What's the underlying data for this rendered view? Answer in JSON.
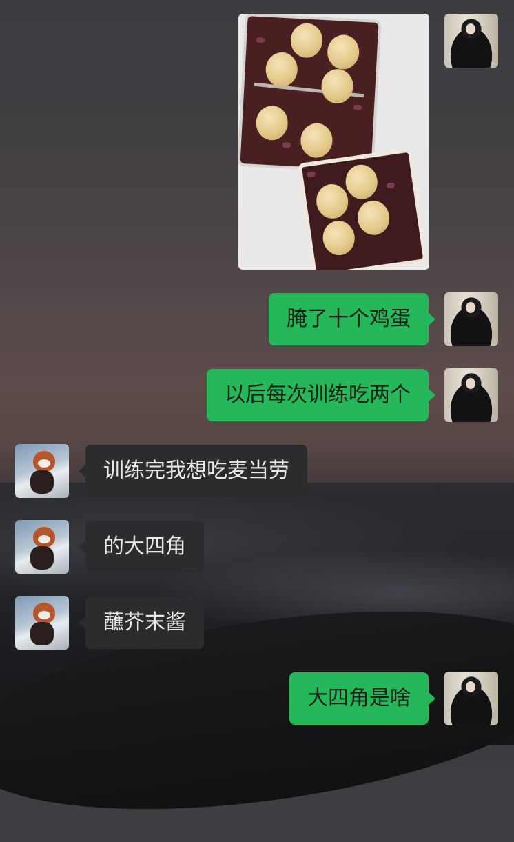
{
  "chat": {
    "messages": [
      {
        "sender": "me",
        "type": "image",
        "image_alt": "装有十个卤鸡蛋的两个保鲜盒"
      },
      {
        "sender": "me",
        "type": "text",
        "text": "腌了十个鸡蛋"
      },
      {
        "sender": "me",
        "type": "text",
        "text": "以后每次训练吃两个"
      },
      {
        "sender": "them",
        "type": "text",
        "text": "训练完我想吃麦当劳"
      },
      {
        "sender": "them",
        "type": "text",
        "text": "的大四角"
      },
      {
        "sender": "them",
        "type": "text",
        "text": "蘸芥末酱"
      },
      {
        "sender": "me",
        "type": "text",
        "text": "大四角是啥"
      }
    ]
  },
  "colors": {
    "my_bubble": "#25b85a",
    "their_bubble": "#2c2c2e",
    "my_text": "#0f1f14",
    "their_text": "#e9e9eb"
  },
  "icons": {
    "my_avatar": "woman-portrait-avatar",
    "their_avatar": "red-panda-avatar"
  }
}
